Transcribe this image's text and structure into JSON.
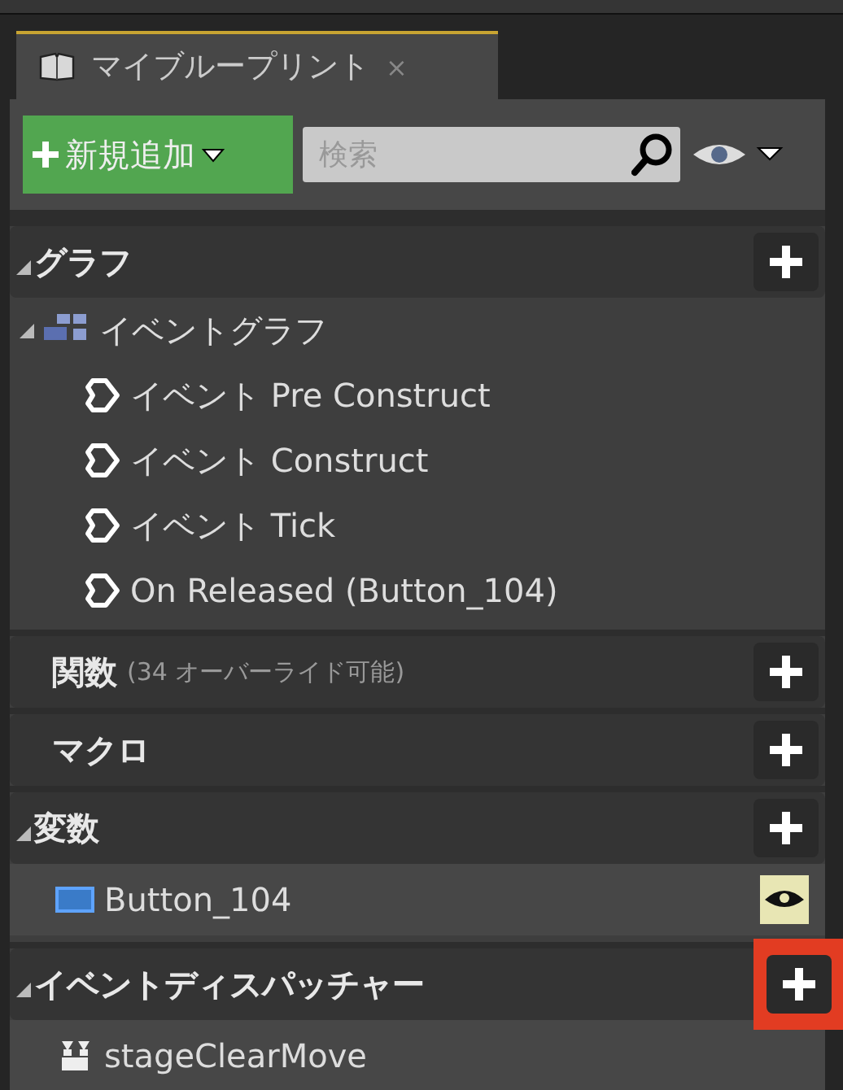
{
  "tab": {
    "title": "マイブループリント",
    "close": "×"
  },
  "toolbar": {
    "add_button": "新規追加",
    "search": {
      "placeholder": "検索"
    }
  },
  "sections": [
    {
      "title": "グラフ",
      "expanded": true,
      "highlighted": false,
      "items": [
        {
          "kind": "graph",
          "label": "イベントグラフ",
          "expanded": true,
          "children": [
            {
              "kind": "event",
              "label": "イベント Pre Construct"
            },
            {
              "kind": "event",
              "label": "イベント Construct"
            },
            {
              "kind": "event",
              "label": "イベント Tick"
            },
            {
              "kind": "event",
              "label": "On Released (Button_104)"
            }
          ]
        }
      ]
    },
    {
      "title": "関数",
      "note": "(34 オーバーライド可能)",
      "expanded": false,
      "highlighted": false
    },
    {
      "title": "マクロ",
      "expanded": false,
      "highlighted": false
    },
    {
      "title": "変数",
      "expanded": true,
      "highlighted": false,
      "items": [
        {
          "kind": "variable",
          "label": "Button_104",
          "visible": true
        }
      ]
    },
    {
      "title": "イベントディスパッチャー",
      "expanded": true,
      "highlighted": true,
      "items": [
        {
          "kind": "dispatcher",
          "label": "stageClearMove"
        }
      ]
    }
  ]
}
